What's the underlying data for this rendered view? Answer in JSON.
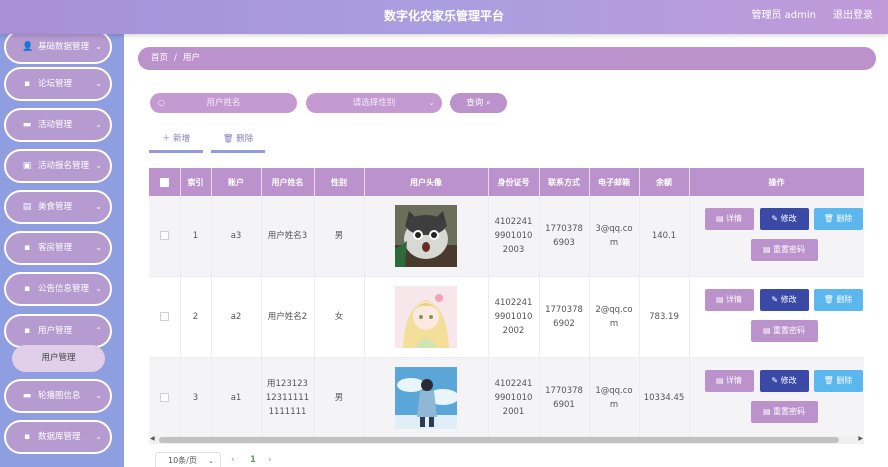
{
  "header": {
    "title": "数字化农家乐管理平台",
    "user": "管理员 admin",
    "logout": "退出登录"
  },
  "sidebar": {
    "items": [
      {
        "label": "基础数据管理",
        "icon": "person-icon",
        "glyph": "👤"
      },
      {
        "label": "论坛管理",
        "icon": "grid-icon",
        "glyph": "▪"
      },
      {
        "label": "活动管理",
        "icon": "ticket-icon",
        "glyph": "▬"
      },
      {
        "label": "活动报名管理",
        "icon": "briefcase-icon",
        "glyph": "▣"
      },
      {
        "label": "美食管理",
        "icon": "document-icon",
        "glyph": "▤"
      },
      {
        "label": "客房管理",
        "icon": "grid-icon",
        "glyph": "▪"
      },
      {
        "label": "公告信息管理",
        "icon": "grid-icon",
        "glyph": "▪"
      },
      {
        "label": "用户管理",
        "icon": "grid-icon",
        "glyph": "▪"
      },
      {
        "label": "轮播图信息",
        "icon": "image-icon",
        "glyph": "▬"
      },
      {
        "label": "数据库管理",
        "icon": "grid-icon",
        "glyph": "▪"
      }
    ],
    "active_sub": "用户管理"
  },
  "breadcrumb": {
    "home": "首页",
    "sep": "/",
    "current": "用户"
  },
  "search": {
    "name_placeholder": "用户姓名",
    "gender_placeholder": "请选择性别",
    "query_label": "查询"
  },
  "actions": {
    "add_label": "新增",
    "delete_label": "删除"
  },
  "table": {
    "headers": [
      "索引",
      "账户",
      "用户姓名",
      "性别",
      "用户头像",
      "身份证号",
      "联系方式",
      "电子邮箱",
      "余额",
      "操作"
    ],
    "rows": [
      {
        "index": "1",
        "account": "a3",
        "name": "用户姓名3",
        "gender": "男",
        "idcard": "410224199010102003",
        "phone": "17703786903",
        "email": "3@qq.com",
        "balance": "140.1",
        "avatar": "cat"
      },
      {
        "index": "2",
        "account": "a2",
        "name": "用户姓名2",
        "gender": "女",
        "idcard": "410224199010102002",
        "phone": "17703786902",
        "email": "2@qq.com",
        "balance": "783.19",
        "avatar": "anime"
      },
      {
        "index": "3",
        "account": "a1",
        "name": "用123123123111111111111",
        "gender": "男",
        "idcard": "410224199010102001",
        "phone": "17703786901",
        "email": "1@qq.com",
        "balance": "10334.45",
        "avatar": "boy"
      }
    ],
    "ops": {
      "detail": "详情",
      "edit": "修改",
      "delete": "删除",
      "reset": "重置密码"
    }
  },
  "pagination": {
    "page_size": "10条/页",
    "current_page": "1"
  },
  "colors": {
    "accent": "#bb92cb",
    "sidebar": "#8e9ee0",
    "edit": "#3b49a6",
    "delete": "#5bb7ee"
  }
}
